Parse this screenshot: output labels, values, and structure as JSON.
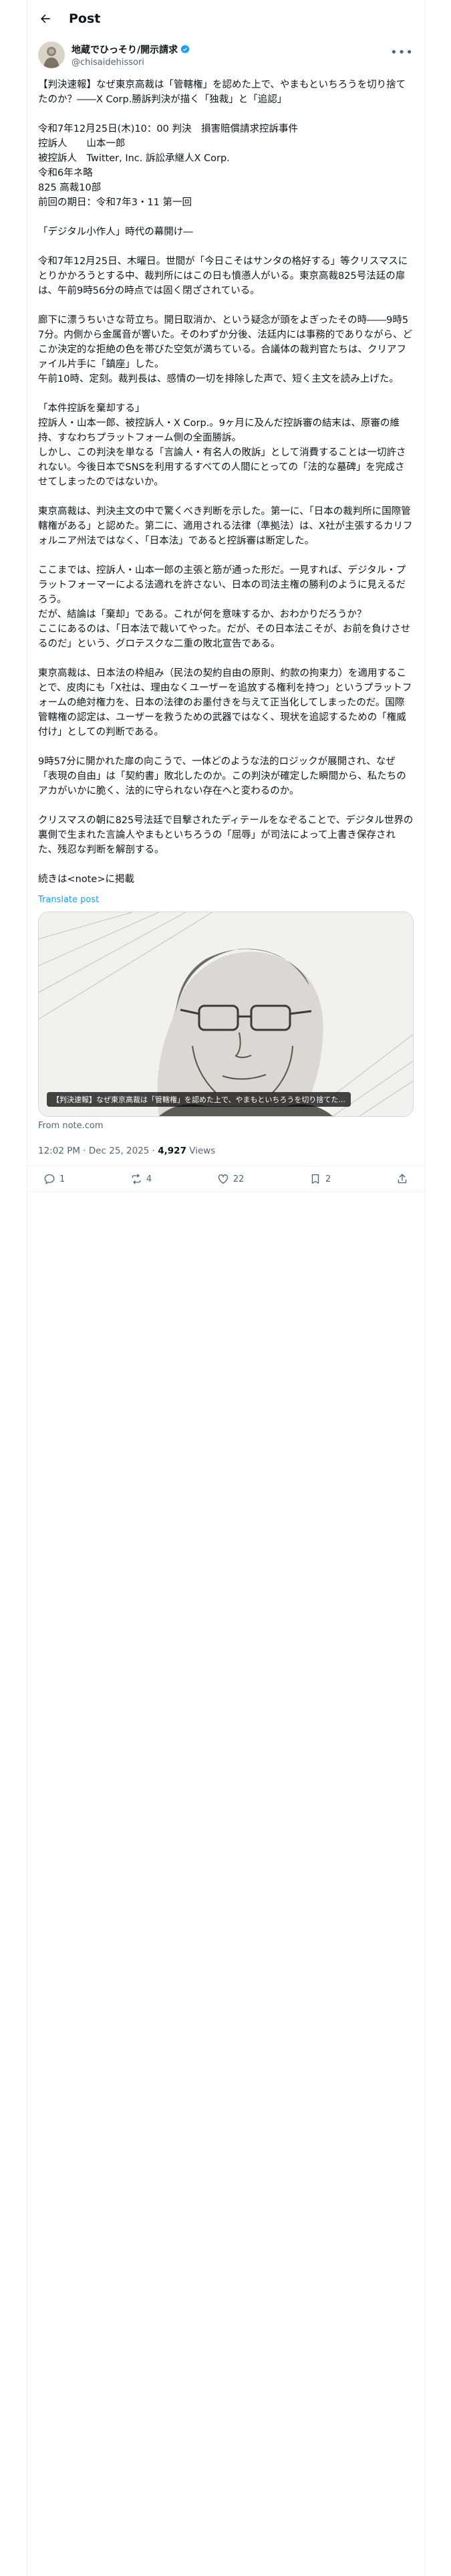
{
  "header": {
    "title": "Post"
  },
  "author": {
    "name": "地蔵でひっそり/開示請求",
    "handle": "@chisaidehissori"
  },
  "post": {
    "paragraphs": [
      "【判決速報】なぜ東京高裁は「管轄権」を認めた上で、やまもといちろうを切り捨てたのか？――X Corp.勝訴判決が描く「独裁」と「追認」",
      "令和7年12月25日(木)10：00 判決　損害賠償請求控訴事件\n控訴人　　山本一郎\n被控訴人　Twitter, Inc. 訴訟承継人X Corp.\n令和6年ネ略\n825 高裁10部\n前回の期日：令和7年3・11 第一回",
      "「デジタル小作人」時代の幕開け―",
      "令和7年12月25日、木曜日。世間が「今日こそはサンタの格好する」等クリスマスにとりかかろうとする中、裁判所にはこの日も憤懣人がいる。東京高裁825号法廷の扉は、午前9時56分の時点では固く閉ざされている。",
      "廊下に漂うちいさな苛立ち。開日取消か、という疑念が頭をよぎったその時――9時57分。内側から金属音が響いた。そのわずか分後、法廷内には事務的でありながら、どこか決定的な拒絶の色を帯びた空気が満ちている。合議体の裁判官たちは、クリアファイル片手に「鎮座」した。\n午前10時、定刻。裁判長は、感情の一切を排除した声で、短く主文を読み上げた。",
      "「本件控訴を棄却する」\n控訴人・山本一郎、被控訴人・X Corp.。9ヶ月に及んだ控訴審の結末は、原審の維持、すなわちプラットフォーム側の全面勝訴。\nしかし、この判決を単なる「言論人・有名人の敗訴」として消費することは一切許されない。今後日本でSNSを利用するすべての人間にとっての「法的な墓碑」を完成させてしまったのではないか。",
      "東京高裁は、判決主文の中で驚くべき判断を示した。第一に、「日本の裁判所に国際管轄権がある」と認めた。第二に、適用される法律（準拠法）は、X社が主張するカリフォルニア州法ではなく、「日本法」であると控訴審は断定した。",
      "ここまでは、控訴人・山本一郎の主張と筋が通った形だ。一見すれば、デジタル・プラットフォーマーによる法適れを許さない、日本の司法主権の勝利のように見えるだろう。\nだが、結論は「棄却」である。これが何を意味するか、おわかりだろうか？\nここにあるのは、「日本法で裁いてやった。だが、その日本法こそが、お前を負けさせるのだ」という、グロテスクな二重の敗北宣告である。",
      "東京高裁は、日本法の枠組み（民法の契約自由の原則、約款の拘束力）を適用することで、皮肉にも「X社は、理由なくユーザーを追放する権利を持つ」というプラットフォームの絶対権力を、日本の法律のお墨付きを与えて正当化してしまったのだ。国際管轄権の認定は、ユーザーを救うための武器ではなく、現状を追認するための「権威付け」としての判断である。",
      "9時57分に開かれた扉の向こうで、一体どのような法的ロジックが展開され、なぜ「表現の自由」は「契約書」敗北したのか。この判決が確定した瞬間から、私たちのアカがいかに脆く、法的に守られない存在へと変わるのか。",
      "クリスマスの朝に825号法廷で目撃されたディテールをなぞることで、デジタル世界の裏側で生まれた言論人やまもといちろうの「屈辱」が司法によって上書き保存された、残忍な判断を解剖する。",
      "続きは<note>に掲載"
    ],
    "translate_label": "Translate post",
    "card_caption": "【判決速報】なぜ東京高裁は「管轄権」を認めた上で、やまもといちろうを切り捨てた...",
    "card_source": "From note.com",
    "timestamp": "12:02 PM · Dec 25, 2025 · ",
    "views_count": "4,927",
    "views_label": " Views"
  },
  "actions": {
    "reply": "1",
    "repost": "4",
    "like": "22",
    "bookmark": "2"
  }
}
